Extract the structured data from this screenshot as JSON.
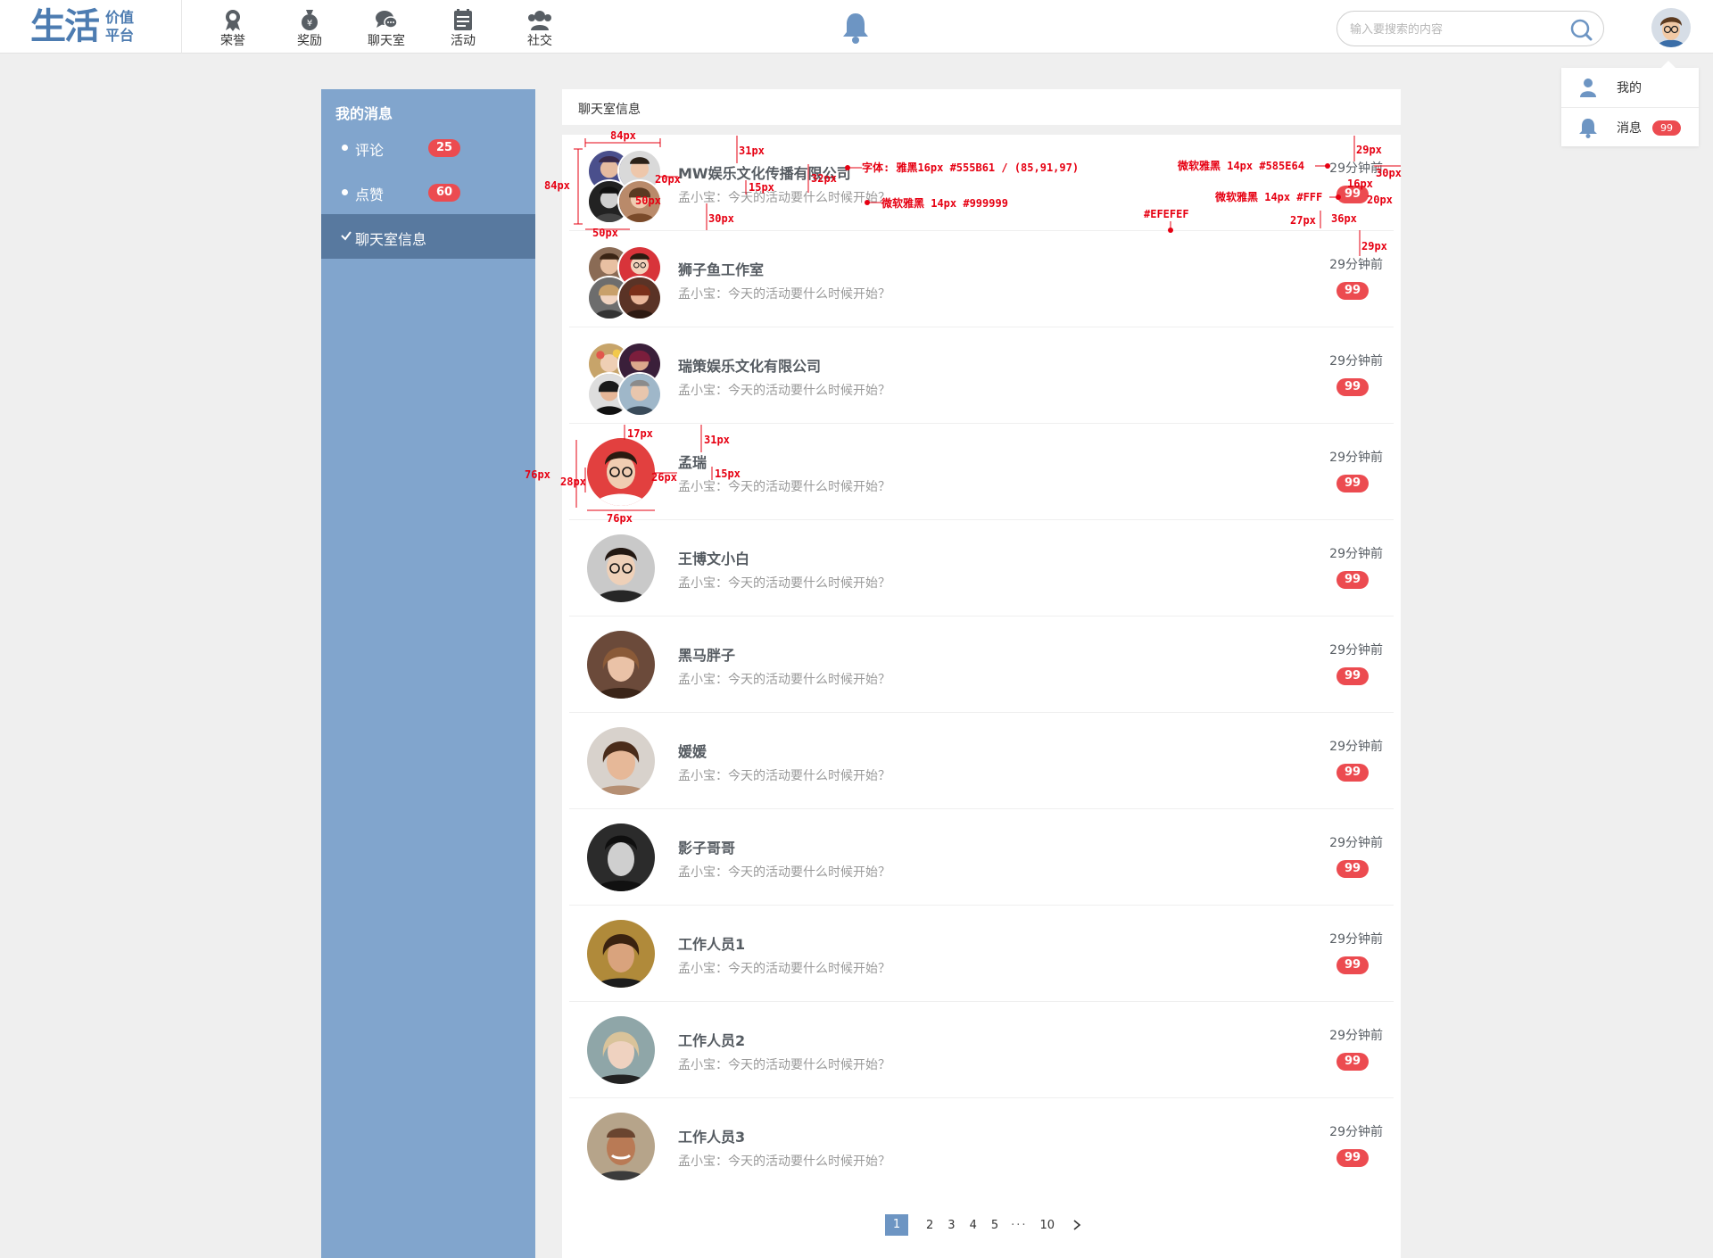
{
  "logo": {
    "main": "生活",
    "sub1": "价值",
    "sub2": "平台"
  },
  "nav": [
    {
      "label": "荣誉",
      "icon": "medal-icon"
    },
    {
      "label": "奖励",
      "icon": "money-bag-icon"
    },
    {
      "label": "聊天室",
      "icon": "chat-icon"
    },
    {
      "label": "活动",
      "icon": "calendar-icon"
    },
    {
      "label": "社交",
      "icon": "social-icon"
    }
  ],
  "search": {
    "placeholder": "输入要搜索的内容"
  },
  "user_menu": {
    "mine": "我的",
    "messages": "消息",
    "messages_count": "99"
  },
  "sidebar": {
    "title": "我的消息",
    "items": [
      {
        "label": "评论",
        "count": "25"
      },
      {
        "label": "点赞",
        "count": "60"
      },
      {
        "label": "聊天室信息",
        "count": ""
      }
    ]
  },
  "content": {
    "title": "聊天室信息",
    "rows": [
      {
        "name": "MW娱乐文化传播有限公司",
        "message": "孟小宝：今天的活动要什么时候开始？",
        "time": "29分钟前",
        "badge": "99"
      },
      {
        "name": "狮子鱼工作室",
        "message": "孟小宝：今天的活动要什么时候开始？",
        "time": "29分钟前",
        "badge": "99"
      },
      {
        "name": "瑞策娱乐文化有限公司",
        "message": "孟小宝：今天的活动要什么时候开始？",
        "time": "29分钟前",
        "badge": "99"
      },
      {
        "name": "孟瑞",
        "message": "孟小宝：今天的活动要什么时候开始？",
        "time": "29分钟前",
        "badge": "99"
      },
      {
        "name": "王博文小白",
        "message": "孟小宝：今天的活动要什么时候开始？",
        "time": "29分钟前",
        "badge": "99"
      },
      {
        "name": "黑马胖子",
        "message": "孟小宝：今天的活动要什么时候开始？",
        "time": "29分钟前",
        "badge": "99"
      },
      {
        "name": "媛媛",
        "message": "孟小宝：今天的活动要什么时候开始？",
        "time": "29分钟前",
        "badge": "99"
      },
      {
        "name": "影子哥哥",
        "message": "孟小宝：今天的活动要什么时候开始？",
        "time": "29分钟前",
        "badge": "99"
      },
      {
        "name": "工作人员1",
        "message": "孟小宝：今天的活动要什么时候开始？",
        "time": "29分钟前",
        "badge": "99"
      },
      {
        "name": "工作人员2",
        "message": "孟小宝：今天的活动要什么时候开始？",
        "time": "29分钟前",
        "badge": "99"
      },
      {
        "name": "工作人员3",
        "message": "孟小宝：今天的活动要什么时候开始？",
        "time": "29分钟前",
        "badge": "99"
      }
    ]
  },
  "pagination": {
    "current": "1",
    "pages": [
      "2",
      "3",
      "4",
      "5"
    ],
    "ellipsis": "···",
    "last": "10"
  },
  "annotations": {
    "w84": "84px",
    "h84": "84px",
    "t31": "31px",
    "g20": "20px",
    "g15": "15px",
    "g32": "32px",
    "g30": "30px",
    "w50a": "50px",
    "w50b": "50px",
    "font_name": "字体: 雅黑16px #555B61 / (85,91,97)",
    "font_msg": "微软雅黑 14px #999999",
    "font_time": "微软雅黑 14px #585E64",
    "font_badge": "微软雅黑 14px #FFF",
    "border_color": "#EFEFEF",
    "r29a": "29px",
    "r30": "30px",
    "r16": "16px",
    "r20": "20px",
    "r27": "27px",
    "r36": "36px",
    "r29b": "29px",
    "s17": "17px",
    "s31": "31px",
    "s76a": "76px",
    "s28": "28px",
    "s26": "26px",
    "s15": "15px",
    "s76b": "76px"
  },
  "colors": {
    "brand": "#4d7cb1",
    "sidebar": "#81a5cd",
    "sidebar_active": "#58799f",
    "badge": "#ec4b50",
    "divider": "#EFEFEF"
  }
}
